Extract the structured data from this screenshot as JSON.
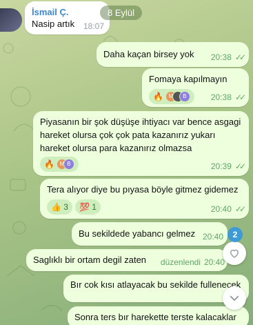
{
  "chat": {
    "date_pill": "8 Eylül",
    "incoming": {
      "sender": "İsmail Ç.",
      "text": "Nasip artık",
      "time": "18:07"
    },
    "messages": [
      {
        "text": "Daha kaçan birsey yok",
        "time": "20:38"
      },
      {
        "text": "Fomaya  kapılmayın",
        "time": "20:38",
        "reactions": [
          "🔥"
        ]
      },
      {
        "text": "Piyasanın bir şok düşüşe ihtiyacı var bence asgagi hareket olursa çok çok pata kazanırız yukarı hareket olursa para kazanırız olmazsa",
        "time": "20:39",
        "reactions": [
          "🔥"
        ]
      },
      {
        "text": "Tera alıyor diye bu pıyasa böyle gitmez gidemez",
        "time": "20:40",
        "reactions": [
          "👍 3",
          "💯 1"
        ]
      },
      {
        "text": "Bu sekildede yabancı gelmez",
        "time": "20:40"
      },
      {
        "text": "Saglıklı bir ortam degil zaten",
        "time": "20:40",
        "edited": "düzenlendi"
      },
      {
        "text": "Bır cok kısı atlayacak bu sekilde fullenecek",
        "time": ""
      },
      {
        "text": "Sonra ters bır harekette terste kalacaklar",
        "time": ""
      }
    ],
    "unread_badge": "2",
    "colors": {
      "outgoing_bubble": "#eeffde",
      "incoming_bubble": "#ffffff",
      "meta_green": "#5fa66a",
      "sender_blue": "#3b87c9",
      "badge_blue": "#3e9bd6"
    }
  }
}
